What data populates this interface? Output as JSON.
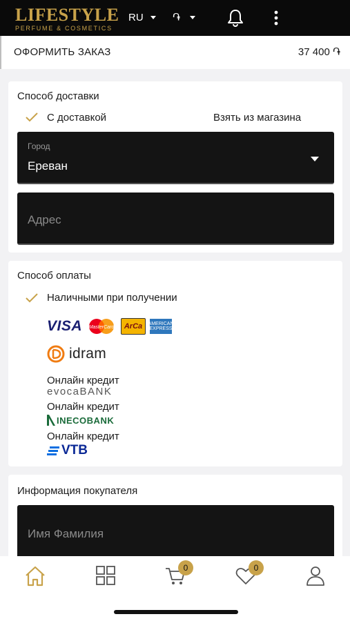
{
  "app": {
    "logo_title": "LIFESTYLE",
    "logo_subtitle": "PERFUME & COSMETICS",
    "language": "RU",
    "currency_symbol": "֏",
    "brand_color": "#c8a24a"
  },
  "order": {
    "title": "ОФОРМИТЬ ЗАКАЗ",
    "total": "37 400 ֏"
  },
  "delivery": {
    "title": "Способ доставки",
    "option_delivery": "С доставкой",
    "option_pickup": "Взять из магазина",
    "selected": "С доставкой",
    "city_label": "Город",
    "city_value": "Ереван",
    "address_placeholder": "Адрес"
  },
  "payment": {
    "title": "Способ оплаты",
    "option_cash": "Наличными при получении",
    "selected": "Наличными при получении",
    "cards": {
      "visa": "VISA",
      "mastercard": "MasterCard",
      "arca": "ArCa",
      "amex": "AMERICAN EXPRESS"
    },
    "idram": "idram",
    "credits": [
      {
        "label": "Онлайн кредит",
        "bank": "evocaBANK"
      },
      {
        "label": "Онлайн кредит",
        "bank": "INECOBANK"
      },
      {
        "label": "Онлайн кредит",
        "bank": "VTB"
      }
    ]
  },
  "buyer": {
    "title": "Информация покупателя",
    "name_placeholder": "Имя Фамилия"
  },
  "nav": {
    "cart_count": "0",
    "wishlist_count": "0",
    "icons": [
      "home-icon",
      "catalog-grid-icon",
      "cart-icon",
      "heart-icon",
      "profile-icon"
    ]
  }
}
